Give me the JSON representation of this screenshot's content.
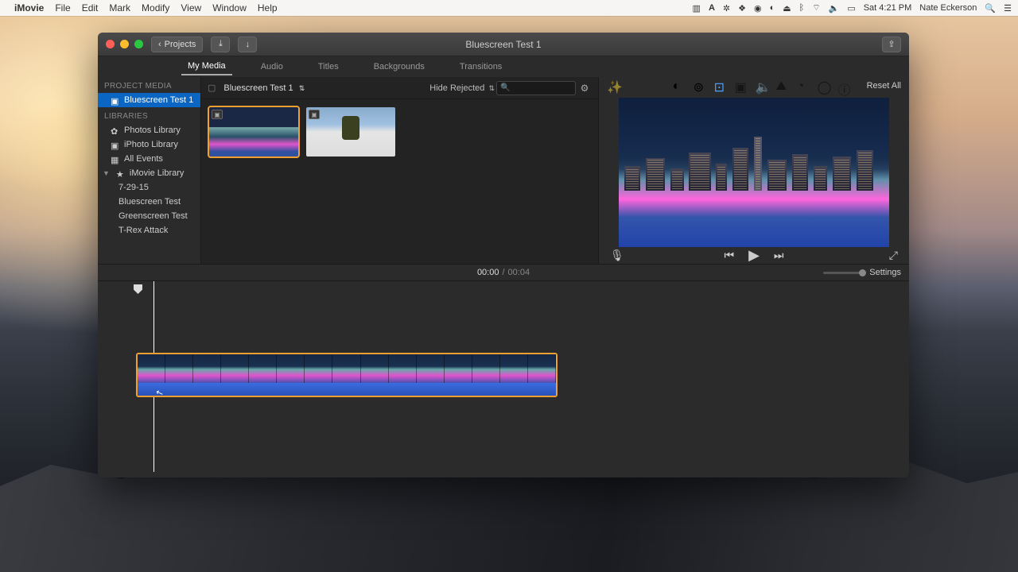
{
  "menubar": {
    "app_name": "iMovie",
    "items": [
      "File",
      "Edit",
      "Mark",
      "Modify",
      "View",
      "Window",
      "Help"
    ],
    "clock": "Sat 4:21 PM",
    "user": "Nate Eckerson"
  },
  "titlebar": {
    "projects_label": "Projects",
    "title": "Bluescreen Test 1"
  },
  "tabs": [
    "My Media",
    "Audio",
    "Titles",
    "Backgrounds",
    "Transitions"
  ],
  "active_tab": "My Media",
  "sidebar": {
    "project_media_header": "PROJECT MEDIA",
    "project": "Bluescreen Test 1",
    "libraries_header": "LIBRARIES",
    "items": [
      {
        "label": "Photos Library"
      },
      {
        "label": "iPhoto Library"
      },
      {
        "label": "All Events"
      },
      {
        "label": "iMovie Library"
      }
    ],
    "sub_items": [
      "7-29-15",
      "Bluescreen Test",
      "Greenscreen Test",
      "T-Rex Attack"
    ]
  },
  "media_toolbar": {
    "event_name": "Bluescreen Test 1",
    "filter_label": "Hide Rejected",
    "search_placeholder": ""
  },
  "preview": {
    "reset_label": "Reset All"
  },
  "playback": {
    "current": "00:00",
    "total": "00:04",
    "settings_label": "Settings"
  }
}
